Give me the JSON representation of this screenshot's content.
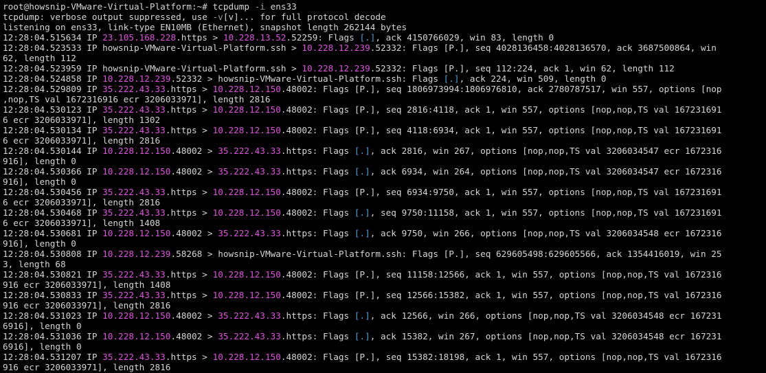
{
  "terminal": {
    "prompt": "root@howsnip-VMware-Virtual-Platform:~# ",
    "command": "tcpdump ",
    "option": "-i",
    "argument": " ens33",
    "lines": [
      [
        {
          "t": "tcpdump: verbose output suppressed, use "
        },
        {
          "t": "-v",
          "c": "opt"
        },
        {
          "t": "[v]... for full protocol decode"
        }
      ],
      [
        {
          "t": "listening on ens33, link-type EN10MB (Ethernet), snapshot length 262144 bytes"
        }
      ],
      [
        {
          "t": "12:28:04.515634 IP "
        },
        {
          "t": "23.105.168.228",
          "c": "ip"
        },
        {
          "t": ".https > "
        },
        {
          "t": "10.228.13.52",
          "c": "ip"
        },
        {
          "t": ".52259: Flags "
        },
        {
          "t": "[.]",
          "c": "flag"
        },
        {
          "t": ", ack 4150766029, win 83, length 0"
        }
      ],
      [
        {
          "t": "12:28:04.523533 IP howsnip-VMware-Virtual-Platform.ssh > "
        },
        {
          "t": "10.228.12.239",
          "c": "ip"
        },
        {
          "t": ".52332: Flags [P.], seq 4028136458:4028136570, ack 3687500864, win"
        }
      ],
      [
        {
          "t": "62, length 112"
        }
      ],
      [
        {
          "t": "12:28:04.523959 IP howsnip-VMware-Virtual-Platform.ssh > "
        },
        {
          "t": "10.228.12.239",
          "c": "ip"
        },
        {
          "t": ".52332: Flags [P.], seq 112:224, ack 1, win 62, length 112"
        }
      ],
      [
        {
          "t": "12:28:04.524858 IP "
        },
        {
          "t": "10.228.12.239",
          "c": "ip"
        },
        {
          "t": ".52332 > howsnip-VMware-Virtual-Platform.ssh: Flags "
        },
        {
          "t": "[.]",
          "c": "flag"
        },
        {
          "t": ", ack 224, win 509, length 0"
        }
      ],
      [
        {
          "t": "12:28:04.529809 IP "
        },
        {
          "t": "35.222.43.33",
          "c": "ip"
        },
        {
          "t": ".https > "
        },
        {
          "t": "10.228.12.150",
          "c": "ip"
        },
        {
          "t": ".48002: Flags [P.], seq 1806973994:1806976810, ack 2780787517, win 557, options [nop"
        }
      ],
      [
        {
          "t": ",nop,TS val 1672316916 ecr 3206033971], length 2816"
        }
      ],
      [
        {
          "t": "12:28:04.530123 IP "
        },
        {
          "t": "35.222.43.33",
          "c": "ip"
        },
        {
          "t": ".https > "
        },
        {
          "t": "10.228.12.150",
          "c": "ip"
        },
        {
          "t": ".48002: Flags [P.], seq 2816:4118, ack 1, win 557, options [nop,nop,TS val 167231691"
        }
      ],
      [
        {
          "t": "6 ecr 3206033971], length 1302"
        }
      ],
      [
        {
          "t": "12:28:04.530134 IP "
        },
        {
          "t": "35.222.43.33",
          "c": "ip"
        },
        {
          "t": ".https > "
        },
        {
          "t": "10.228.12.150",
          "c": "ip"
        },
        {
          "t": ".48002: Flags [P.], seq 4118:6934, ack 1, win 557, options [nop,nop,TS val 167231691"
        }
      ],
      [
        {
          "t": "6 ecr 3206033971], length 2816"
        }
      ],
      [
        {
          "t": "12:28:04.530144 IP "
        },
        {
          "t": "10.228.12.150",
          "c": "ip"
        },
        {
          "t": ".48002 > "
        },
        {
          "t": "35.222.43.33",
          "c": "ip"
        },
        {
          "t": ".https: Flags "
        },
        {
          "t": "[.]",
          "c": "flag"
        },
        {
          "t": ", ack 2816, win 267, options [nop,nop,TS val 3206034547 ecr 1672316"
        }
      ],
      [
        {
          "t": "916], length 0"
        }
      ],
      [
        {
          "t": "12:28:04.530366 IP "
        },
        {
          "t": "10.228.12.150",
          "c": "ip"
        },
        {
          "t": ".48002 > "
        },
        {
          "t": "35.222.43.33",
          "c": "ip"
        },
        {
          "t": ".https: Flags "
        },
        {
          "t": "[.]",
          "c": "flag"
        },
        {
          "t": ", ack 6934, win 264, options [nop,nop,TS val 3206034547 ecr 1672316"
        }
      ],
      [
        {
          "t": "916], length 0"
        }
      ],
      [
        {
          "t": "12:28:04.530456 IP "
        },
        {
          "t": "35.222.43.33",
          "c": "ip"
        },
        {
          "t": ".https > "
        },
        {
          "t": "10.228.12.150",
          "c": "ip"
        },
        {
          "t": ".48002: Flags [P.], seq 6934:9750, ack 1, win 557, options [nop,nop,TS val 167231691"
        }
      ],
      [
        {
          "t": "6 ecr 3206033971], length 2816"
        }
      ],
      [
        {
          "t": "12:28:04.530468 IP "
        },
        {
          "t": "35.222.43.33",
          "c": "ip"
        },
        {
          "t": ".https > "
        },
        {
          "t": "10.228.12.150",
          "c": "ip"
        },
        {
          "t": ".48002: Flags "
        },
        {
          "t": "[.]",
          "c": "flag"
        },
        {
          "t": ", seq 9750:11158, ack 1, win 557, options [nop,nop,TS val 167231691"
        }
      ],
      [
        {
          "t": "6 ecr 3206033971], length 1408"
        }
      ],
      [
        {
          "t": "12:28:04.530681 IP "
        },
        {
          "t": "10.228.12.150",
          "c": "ip"
        },
        {
          "t": ".48002 > "
        },
        {
          "t": "35.222.43.33",
          "c": "ip"
        },
        {
          "t": ".https: Flags "
        },
        {
          "t": "[.]",
          "c": "flag"
        },
        {
          "t": ", ack 9750, win 266, options [nop,nop,TS val 3206034548 ecr 1672316"
        }
      ],
      [
        {
          "t": "916], length 0"
        }
      ],
      [
        {
          "t": "12:28:04.530808 IP "
        },
        {
          "t": "10.228.12.239",
          "c": "ip"
        },
        {
          "t": ".58268 > howsnip-VMware-Virtual-Platform.ssh: Flags [P.], seq 629605498:629605566, ack 1354416019, win 25"
        }
      ],
      [
        {
          "t": "3, length 68"
        }
      ],
      [
        {
          "t": "12:28:04.530821 IP "
        },
        {
          "t": "35.222.43.33",
          "c": "ip"
        },
        {
          "t": ".https > "
        },
        {
          "t": "10.228.12.150",
          "c": "ip"
        },
        {
          "t": ".48002: Flags [P.], seq 11158:12566, ack 1, win 557, options [nop,nop,TS val 1672316"
        }
      ],
      [
        {
          "t": "916 ecr 3206033971], length 1408"
        }
      ],
      [
        {
          "t": "12:28:04.530833 IP "
        },
        {
          "t": "35.222.43.33",
          "c": "ip"
        },
        {
          "t": ".https > "
        },
        {
          "t": "10.228.12.150",
          "c": "ip"
        },
        {
          "t": ".48002: Flags [P.], seq 12566:15382, ack 1, win 557, options [nop,nop,TS val 1672316"
        }
      ],
      [
        {
          "t": "916 ecr 3206033971], length 2816"
        }
      ],
      [
        {
          "t": "12:28:04.531023 IP "
        },
        {
          "t": "10.228.12.150",
          "c": "ip"
        },
        {
          "t": ".48002 > "
        },
        {
          "t": "35.222.43.33",
          "c": "ip"
        },
        {
          "t": ".https: Flags "
        },
        {
          "t": "[.]",
          "c": "flag"
        },
        {
          "t": ", ack 12566, win 266, options [nop,nop,TS val 3206034548 ecr 167231"
        }
      ],
      [
        {
          "t": "6916], length 0"
        }
      ],
      [
        {
          "t": "12:28:04.531036 IP "
        },
        {
          "t": "10.228.12.150",
          "c": "ip"
        },
        {
          "t": ".48002 > "
        },
        {
          "t": "35.222.43.33",
          "c": "ip"
        },
        {
          "t": ".https: Flags "
        },
        {
          "t": "[.]",
          "c": "flag"
        },
        {
          "t": ", ack 15382, win 267, options [nop,nop,TS val 3206034548 ecr 167231"
        }
      ],
      [
        {
          "t": "6916], length 0"
        }
      ],
      [
        {
          "t": "12:28:04.531207 IP "
        },
        {
          "t": "35.222.43.33",
          "c": "ip"
        },
        {
          "t": ".https > "
        },
        {
          "t": "10.228.12.150",
          "c": "ip"
        },
        {
          "t": ".48002: Flags [P.], seq 15382:18198, ack 1, win 557, options [nop,nop,TS val 1672316"
        }
      ],
      [
        {
          "t": "916 ecr 3206033971], length 2816"
        }
      ]
    ]
  },
  "colors": {
    "background": "#000000",
    "text": "#d6d6d6",
    "ip_address": "#e24fe2",
    "ack_flag": "#4ea0d6",
    "option": "#9c9c9c"
  }
}
